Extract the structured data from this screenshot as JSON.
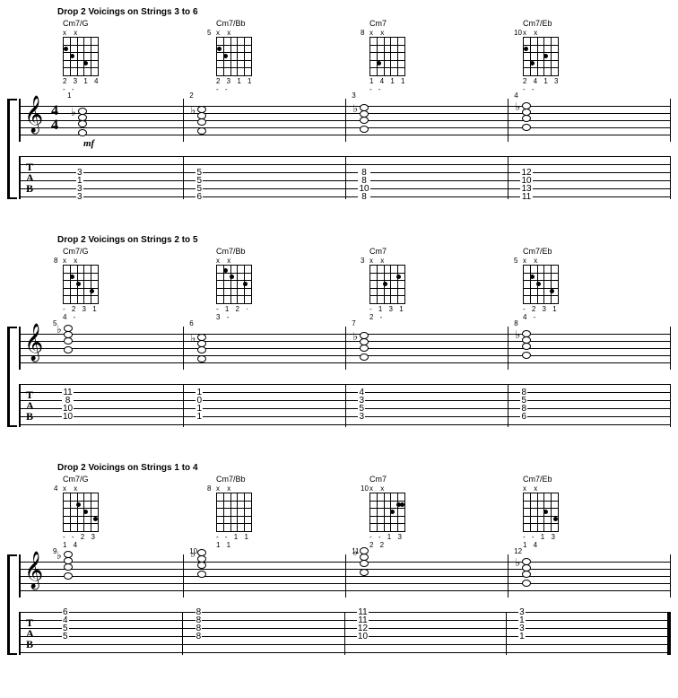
{
  "sections": [
    {
      "title": "Drop 2 Voicings on Strings 3 to 6",
      "chords": [
        {
          "name": "Cm7/G",
          "fret_pos": "",
          "top_marks": "    x x",
          "fingering": "2 3 1 4 - -",
          "tab": [
            "3",
            "1",
            "3",
            "3"
          ],
          "meas": "1"
        },
        {
          "name": "Cm7/Bb",
          "fret_pos": "5",
          "top_marks": "    x x",
          "fingering": "2 3 1 1 - -",
          "tab": [
            "5",
            "5",
            "5",
            "6"
          ],
          "meas": "2"
        },
        {
          "name": "Cm7",
          "fret_pos": "8",
          "top_marks": "    x x",
          "fingering": "1 4 1 1 - -",
          "tab": [
            "8",
            "8",
            "10",
            "8"
          ],
          "meas": "3"
        },
        {
          "name": "Cm7/Eb",
          "fret_pos": "10",
          "top_marks": "    x x",
          "fingering": "2 4 1 3 - -",
          "tab": [
            "12",
            "10",
            "13",
            "11"
          ],
          "meas": "4"
        }
      ]
    },
    {
      "title": "Drop 2 Voicings on Strings 2 to 5",
      "chords": [
        {
          "name": "Cm7/G",
          "fret_pos": "8",
          "top_marks": "x    x",
          "fingering": "- 2 3 1 4 -",
          "tab": [
            "11",
            "8",
            "10",
            "10"
          ],
          "meas": "5"
        },
        {
          "name": "Cm7/Bb",
          "fret_pos": "",
          "top_marks": "x    x",
          "fingering": "- 1 2 · 3 -",
          "tab": [
            "1",
            "0",
            "1",
            "1"
          ],
          "meas": "6"
        },
        {
          "name": "Cm7",
          "fret_pos": "3",
          "top_marks": "x    x",
          "fingering": "- 1 3 1 2 -",
          "tab": [
            "4",
            "3",
            "5",
            "3"
          ],
          "meas": "7"
        },
        {
          "name": "Cm7/Eb",
          "fret_pos": "5",
          "top_marks": "x    x",
          "fingering": "- 2 3 1 4 -",
          "tab": [
            "8",
            "5",
            "8",
            "6"
          ],
          "meas": "8"
        }
      ]
    },
    {
      "title": "Drop 2 Voicings on Strings 1 to 4",
      "chords": [
        {
          "name": "Cm7/G",
          "fret_pos": "4",
          "top_marks": "x x",
          "fingering": "- - 2 3 1 4",
          "tab": [
            "6",
            "4",
            "5",
            "5"
          ],
          "meas": "9"
        },
        {
          "name": "Cm7/Bb",
          "fret_pos": "8",
          "top_marks": "x x",
          "fingering": "- - 1 1 1 1",
          "tab": [
            "8",
            "8",
            "8",
            "8"
          ],
          "meas": "10"
        },
        {
          "name": "Cm7",
          "fret_pos": "10",
          "top_marks": "x x",
          "fingering": "- - 1 3 2 2",
          "tab": [
            "11",
            "11",
            "12",
            "10"
          ],
          "meas": "11"
        },
        {
          "name": "Cm7/Eb",
          "fret_pos": "",
          "top_marks": "x x",
          "fingering": "- - 1 3 1 4",
          "tab": [
            "3",
            "1",
            "3",
            "1"
          ],
          "meas": "12"
        }
      ]
    }
  ],
  "timesig_top": "4",
  "timesig_bot": "4",
  "dynamic": "mf",
  "tab_label_t": "T",
  "tab_label_a": "A",
  "tab_label_b": "B"
}
